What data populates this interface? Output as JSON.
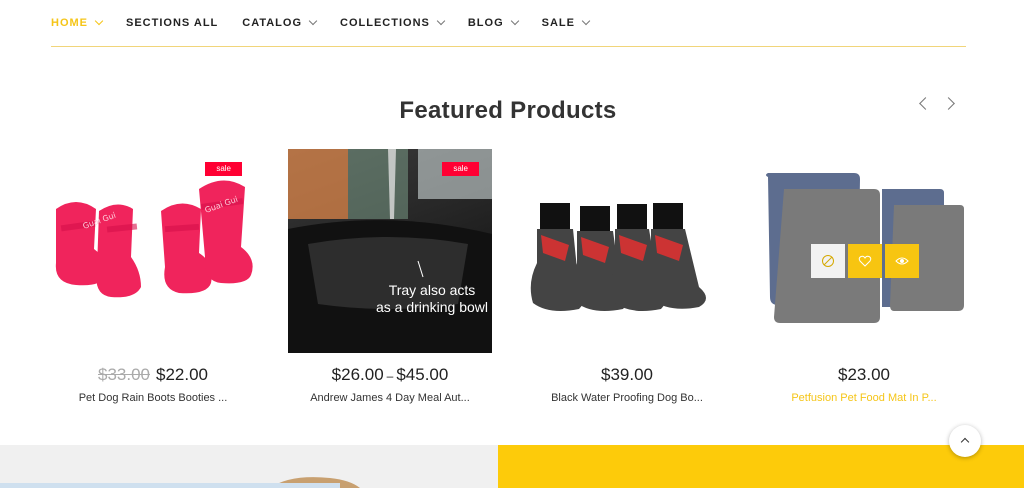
{
  "nav": {
    "items": [
      {
        "label": "HOME",
        "active": true
      },
      {
        "label": "SECTIONS ALL",
        "active": false
      },
      {
        "label": "CATALOG",
        "active": false
      },
      {
        "label": "COLLECTIONS",
        "active": false
      },
      {
        "label": "BLOG",
        "active": false
      },
      {
        "label": "SALE",
        "active": false
      }
    ]
  },
  "section": {
    "title": "Featured Products"
  },
  "products": [
    {
      "badge": "sale",
      "old_price": "$33.00",
      "price": "$22.00",
      "name": "Pet Dog Rain Boots Booties ...",
      "image_text": "Guai Gui"
    },
    {
      "badge": "sale",
      "price_from": "$26.00",
      "price_sep": "–",
      "price_to": "$45.00",
      "name": "Andrew James 4 Day Meal Aut...",
      "image_text": "Tray also acts\nas a drinking bowl"
    },
    {
      "price": "$39.00",
      "name": "Black Water Proofing Dog Bo..."
    },
    {
      "price": "$23.00",
      "name": "Petfusion Pet Food Mat In P..."
    }
  ],
  "colors": {
    "accent": "#f5c518",
    "sale_badge": "#ff0033",
    "banner_right": "#fdcb0a"
  }
}
